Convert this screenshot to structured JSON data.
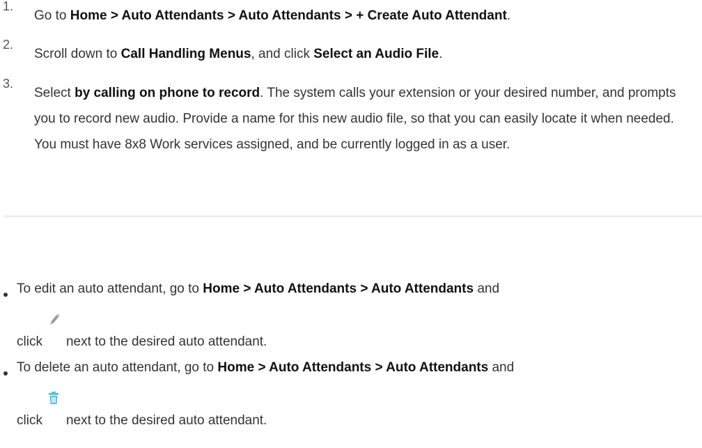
{
  "steps": [
    {
      "number": "1.",
      "parts": [
        {
          "text": "Go to ",
          "bold": false
        },
        {
          "text": "Home > Auto Attendants > Auto Attendants > + Create Auto Attendant",
          "bold": true
        },
        {
          "text": ".",
          "bold": false
        }
      ]
    },
    {
      "number": "2.",
      "parts": [
        {
          "text": "Scroll down to ",
          "bold": false
        },
        {
          "text": "Call Handling Menus",
          "bold": true
        },
        {
          "text": ", and click ",
          "bold": false
        },
        {
          "text": "Select an Audio File",
          "bold": true
        },
        {
          "text": ".",
          "bold": false
        }
      ]
    },
    {
      "number": "3.",
      "parts": [
        {
          "text": "Select ",
          "bold": false
        },
        {
          "text": "by calling on phone to record",
          "bold": true
        },
        {
          "text": ". The system calls your extension or your desired number, and prompts you to record new audio. Provide a name for this new audio file, so that you can easily locate it when needed. You must have 8x8 Work services assigned, and be currently logged in as a user.",
          "bold": false
        }
      ]
    }
  ],
  "bullets": [
    {
      "prefix": "To edit an auto attendant, go to ",
      "path": "Home > Auto Attendants > Auto Attendants",
      "suffix": " and",
      "click_text": "click",
      "after_icon": "next to the desired auto attendant.",
      "icon": "pencil-icon"
    },
    {
      "prefix": "To delete an auto attendant, go to ",
      "path": "Home > Auto Attendants > Auto Attendants",
      "suffix": " and",
      "click_text": "click",
      "after_icon": "next to the desired auto attendant.",
      "icon": "trash-icon"
    }
  ],
  "colors": {
    "text": "#333333",
    "divider": "#eeeeee",
    "trash_icon": "#5bc0de",
    "pencil_icon": "#9a9a9a"
  }
}
